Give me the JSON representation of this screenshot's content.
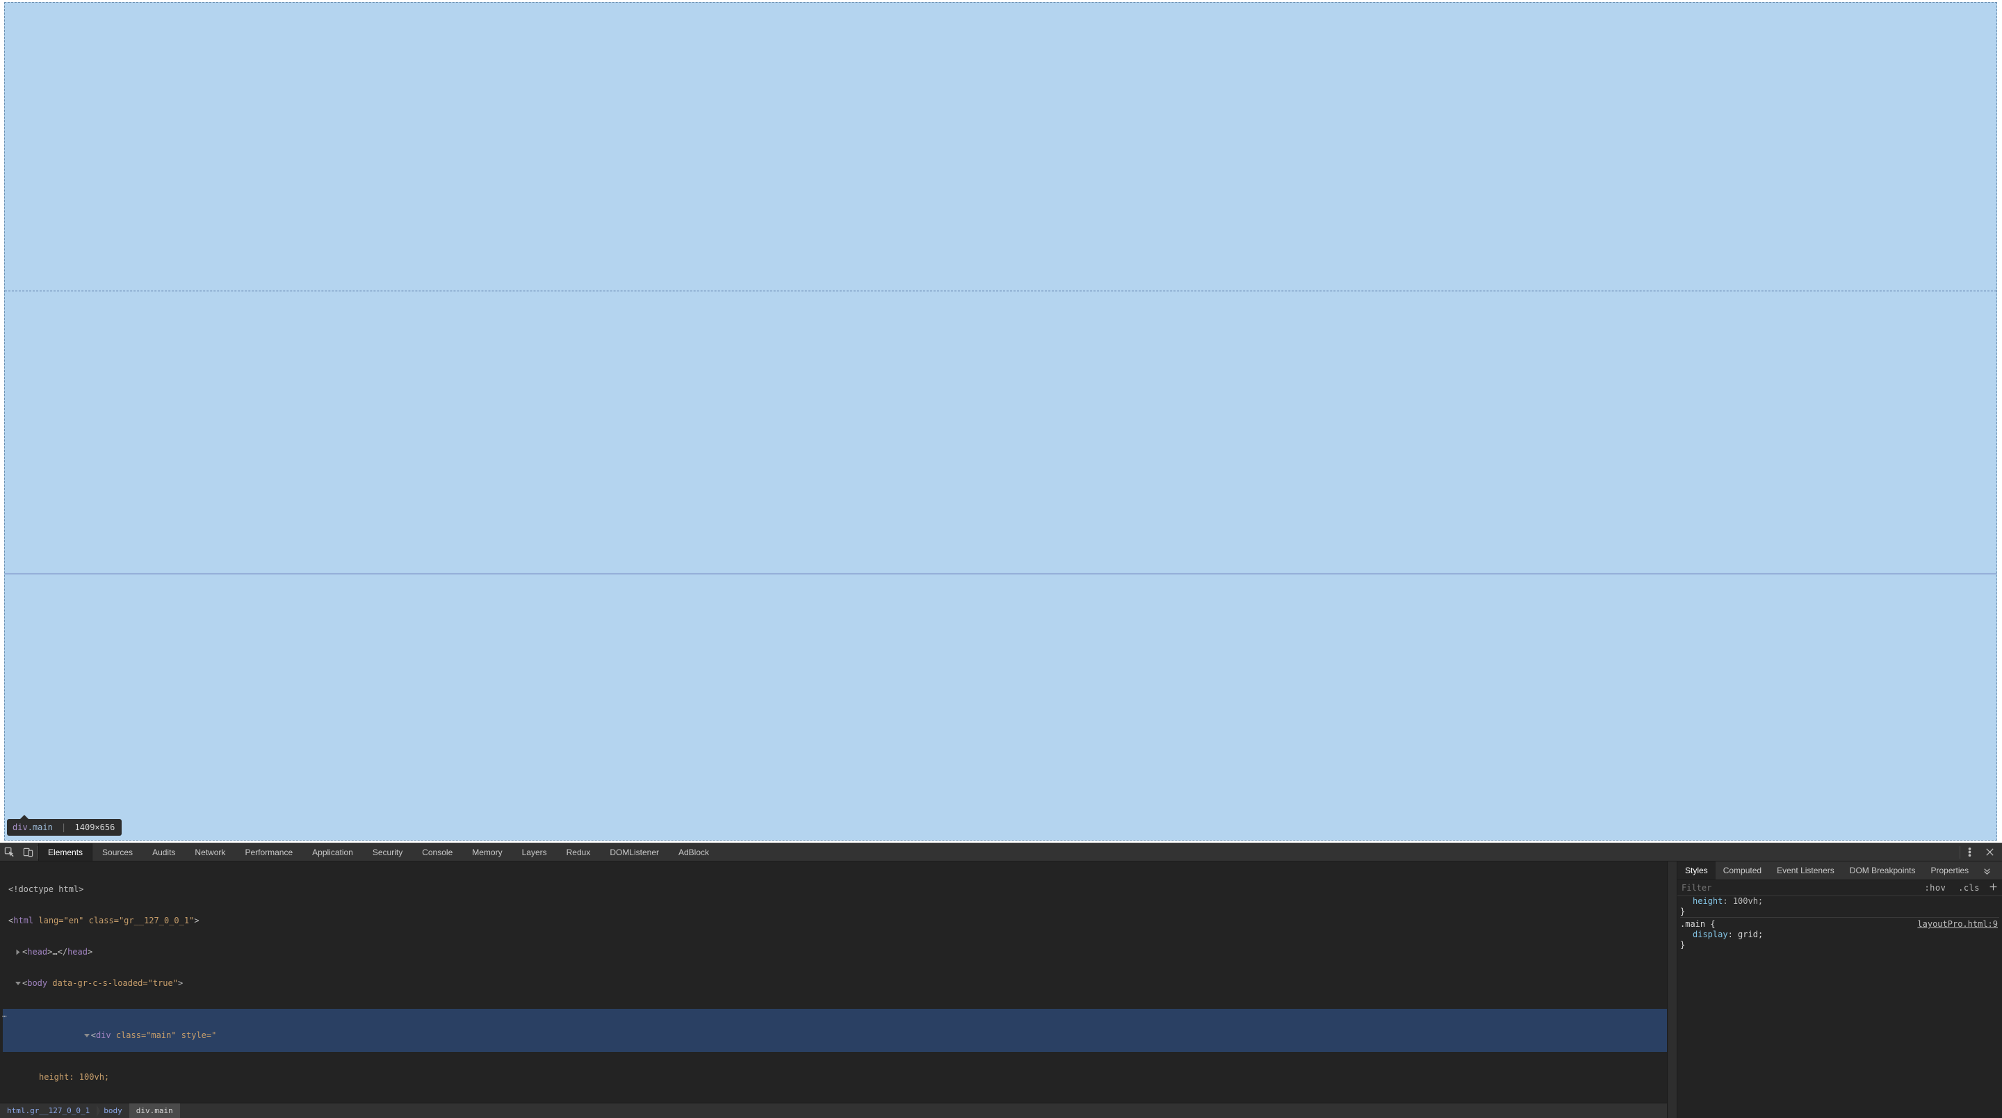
{
  "viewport": {
    "overlay_color": "#b4d4ef",
    "tooltip": {
      "tag": "div",
      "class": ".main",
      "separator": "|",
      "dimensions": "1409×656"
    }
  },
  "devtools": {
    "main_tabs": [
      "Elements",
      "Sources",
      "Audits",
      "Network",
      "Performance",
      "Application",
      "Security",
      "Console",
      "Memory",
      "Layers",
      "Redux",
      "DOMListener",
      "AdBlock"
    ],
    "main_tab_active_index": 0,
    "dom": {
      "line0": "<!doctype html>",
      "line1": {
        "tag": "html",
        "attrs": " lang=\"en\" class=\"gr__127_0_0_1\"",
        "close": ">"
      },
      "line2": {
        "open": "<head>",
        "mid": "…",
        "close": "</head>"
      },
      "line3": {
        "tag": "body",
        "attrs": " data-gr-c-s-loaded=\"true\"",
        "close": ">"
      },
      "line4": {
        "tag": "div",
        "attrs": " class=\"main\" style=\"",
        "tail": ""
      },
      "line5": "height: 100vh;"
    },
    "breadcrumb": [
      "html.gr__127_0_0_1",
      "body",
      "div.main"
    ],
    "breadcrumb_selected_index": 2,
    "styles_tabs": [
      "Styles",
      "Computed",
      "Event Listeners",
      "DOM Breakpoints",
      "Properties"
    ],
    "styles_tab_active_index": 0,
    "filter_placeholder": "Filter",
    "hov_label": ":hov",
    "cls_label": ".cls",
    "truncated_rule": {
      "prop_fragment": "height",
      "val_fragment": "100vh;"
    },
    "closing_brace": "}",
    "rule": {
      "selector": ".main",
      "open_brace": "{",
      "source": "layoutPro.html:9",
      "prop": "display",
      "value": "grid",
      "semicolon": ";"
    },
    "closing_brace2": "}"
  }
}
